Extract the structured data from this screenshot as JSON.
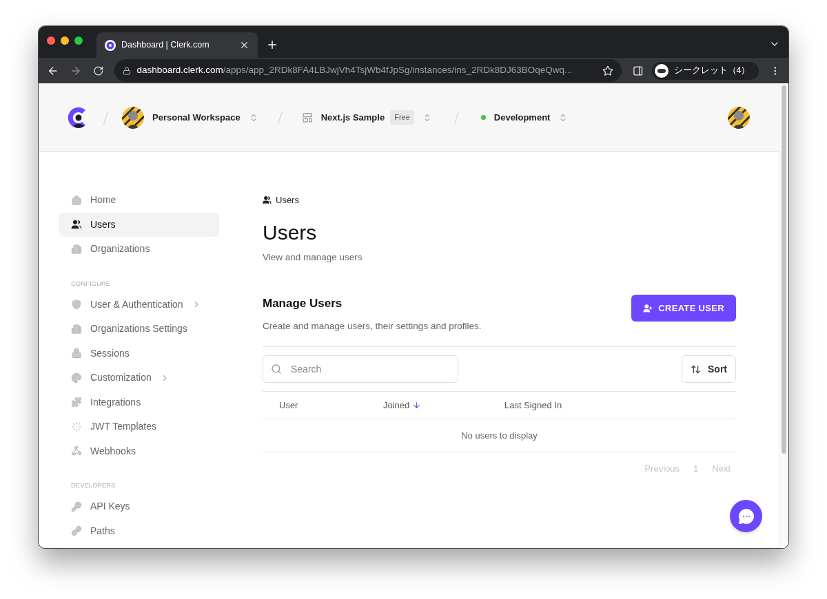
{
  "browser": {
    "tabs": [
      {
        "title": "Dashboard | Clerk.com",
        "selected": true
      }
    ],
    "url_host": "dashboard.clerk.com",
    "url_path": "/apps/app_2RDk8FA4LBJwjVh4TsjWb4fJpSg/instances/ins_2RDk8DJ63BOqeQwq...",
    "profile_label": "シークレット（4）"
  },
  "header": {
    "workspace": "Personal Workspace",
    "app": "Next.js Sample",
    "app_badge": "Free",
    "environment": {
      "label": "Development",
      "color": "#3ec44b"
    }
  },
  "sidebar": {
    "sections": [
      {
        "items": [
          {
            "label": "Home",
            "selected": false,
            "expandable": false
          },
          {
            "label": "Users",
            "selected": true,
            "expandable": false
          },
          {
            "label": "Organizations",
            "selected": false,
            "expandable": false
          }
        ]
      },
      {
        "heading": "CONFIGURE",
        "items": [
          {
            "label": "User & Authentication",
            "selected": false,
            "expandable": true
          },
          {
            "label": "Organizations Settings",
            "selected": false,
            "expandable": false
          },
          {
            "label": "Sessions",
            "selected": false,
            "expandable": false
          },
          {
            "label": "Customization",
            "selected": false,
            "expandable": true
          },
          {
            "label": "Integrations",
            "selected": false,
            "expandable": false
          },
          {
            "label": "JWT Templates",
            "selected": false,
            "expandable": false
          },
          {
            "label": "Webhooks",
            "selected": false,
            "expandable": false
          }
        ]
      },
      {
        "heading": "DEVELOPERS",
        "items": [
          {
            "label": "API Keys",
            "selected": false,
            "expandable": false
          },
          {
            "label": "Paths",
            "selected": false,
            "expandable": false
          }
        ]
      }
    ]
  },
  "page": {
    "breadcrumb": "Users",
    "title": "Users",
    "subtitle": "View and manage users"
  },
  "section": {
    "title": "Manage Users",
    "description": "Create and manage users, their settings and profiles.",
    "create_button": "CREATE USER",
    "search_placeholder": "Search",
    "sort_button": "Sort",
    "columns": [
      {
        "label": "User",
        "sorted": false
      },
      {
        "label": "Joined",
        "sorted": true
      },
      {
        "label": "Last Signed In",
        "sorted": false
      }
    ],
    "empty_message": "No users to display",
    "pagination": [
      {
        "label": "Previous",
        "disabled": true
      },
      {
        "label": "1",
        "disabled": true
      },
      {
        "label": "Next",
        "disabled": true
      }
    ]
  }
}
